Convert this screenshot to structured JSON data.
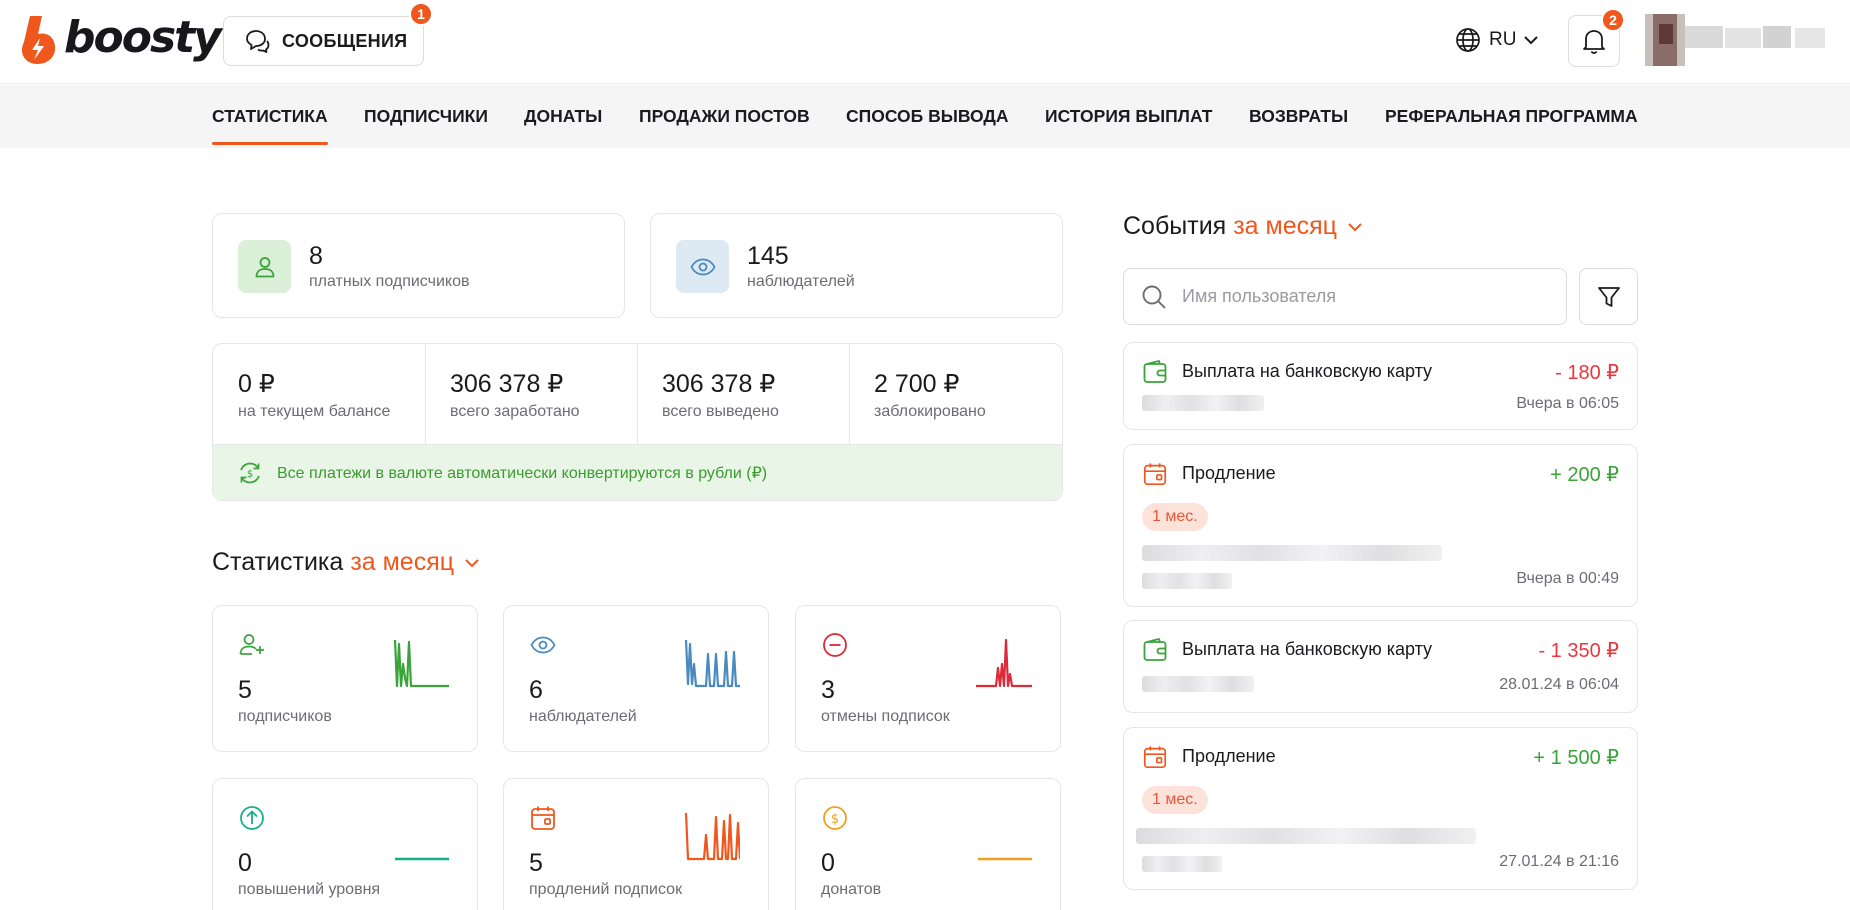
{
  "header": {
    "logo_text": "boosty",
    "messages_label": "СООБЩЕНИЯ",
    "messages_badge": "1",
    "language": "RU",
    "notifications_badge": "2",
    "accent_color": "#f0571d"
  },
  "tabs": [
    {
      "label": "СТАТИСТИКА",
      "active": true
    },
    {
      "label": "ПОДПИСЧИКИ"
    },
    {
      "label": "ДОНАТЫ"
    },
    {
      "label": "ПРОДАЖИ ПОСТОВ"
    },
    {
      "label": "СПОСОБ ВЫВОДА"
    },
    {
      "label": "ИСТОРИЯ ВЫПЛАТ"
    },
    {
      "label": "ВОЗВРАТЫ"
    },
    {
      "label": "РЕФЕРАЛЬНАЯ ПРОГРАММА"
    }
  ],
  "summary": {
    "paid": {
      "value": "8",
      "label": "платных подписчиков",
      "icon": "user-icon"
    },
    "followers": {
      "value": "145",
      "label": "наблюдателей",
      "icon": "eye-icon"
    }
  },
  "balance": {
    "items": [
      {
        "value": "0 ₽",
        "label": "на текущем балансе"
      },
      {
        "value": "306 378 ₽",
        "label": "всего заработано"
      },
      {
        "value": "306 378 ₽",
        "label": "всего выведено"
      },
      {
        "value": "2 700 ₽",
        "label": "заблокировано"
      }
    ],
    "notice": "Все платежи в валюте автоматически конвертируются в рубли (₽)"
  },
  "stats": {
    "title": "Статистика",
    "period": "за месяц",
    "cards": [
      {
        "value": "5",
        "label": "подписчиков",
        "icon": "user-plus-icon",
        "color": "#3aa33a"
      },
      {
        "value": "6",
        "label": "наблюдателей",
        "icon": "eye-icon",
        "color": "#4a8bbf"
      },
      {
        "value": "3",
        "label": "отмены подписок",
        "icon": "minus-circle-icon",
        "color": "#d92b3a"
      },
      {
        "value": "0",
        "label": "повышений уровня",
        "icon": "arrow-up-circle-icon",
        "color": "#14b08a"
      },
      {
        "value": "5",
        "label": "продлений подписок",
        "icon": "calendar-icon",
        "color": "#f0571d"
      },
      {
        "value": "0",
        "label": "донатов",
        "icon": "coin-icon",
        "color": "#f0a020"
      }
    ]
  },
  "events": {
    "title": "События",
    "period": "за месяц",
    "search_placeholder": "Имя пользователя",
    "items": [
      {
        "title": "Выплата на банковскую карту",
        "amount": "- 180 ₽",
        "time": "Вчера в 06:05",
        "icon": "wallet-icon"
      },
      {
        "title": "Продление",
        "amount": "+ 200 ₽",
        "tag": "1 мес.",
        "time": "Вчера в 00:49",
        "icon": "calendar-icon"
      },
      {
        "title": "Выплата на банковскую карту",
        "amount": "- 1 350 ₽",
        "time": "28.01.24 в 06:04",
        "icon": "wallet-icon"
      },
      {
        "title": "Продление",
        "amount": "+ 1 500 ₽",
        "tag": "1 мес.",
        "time": "27.01.24 в 21:16",
        "icon": "calendar-icon"
      }
    ]
  }
}
